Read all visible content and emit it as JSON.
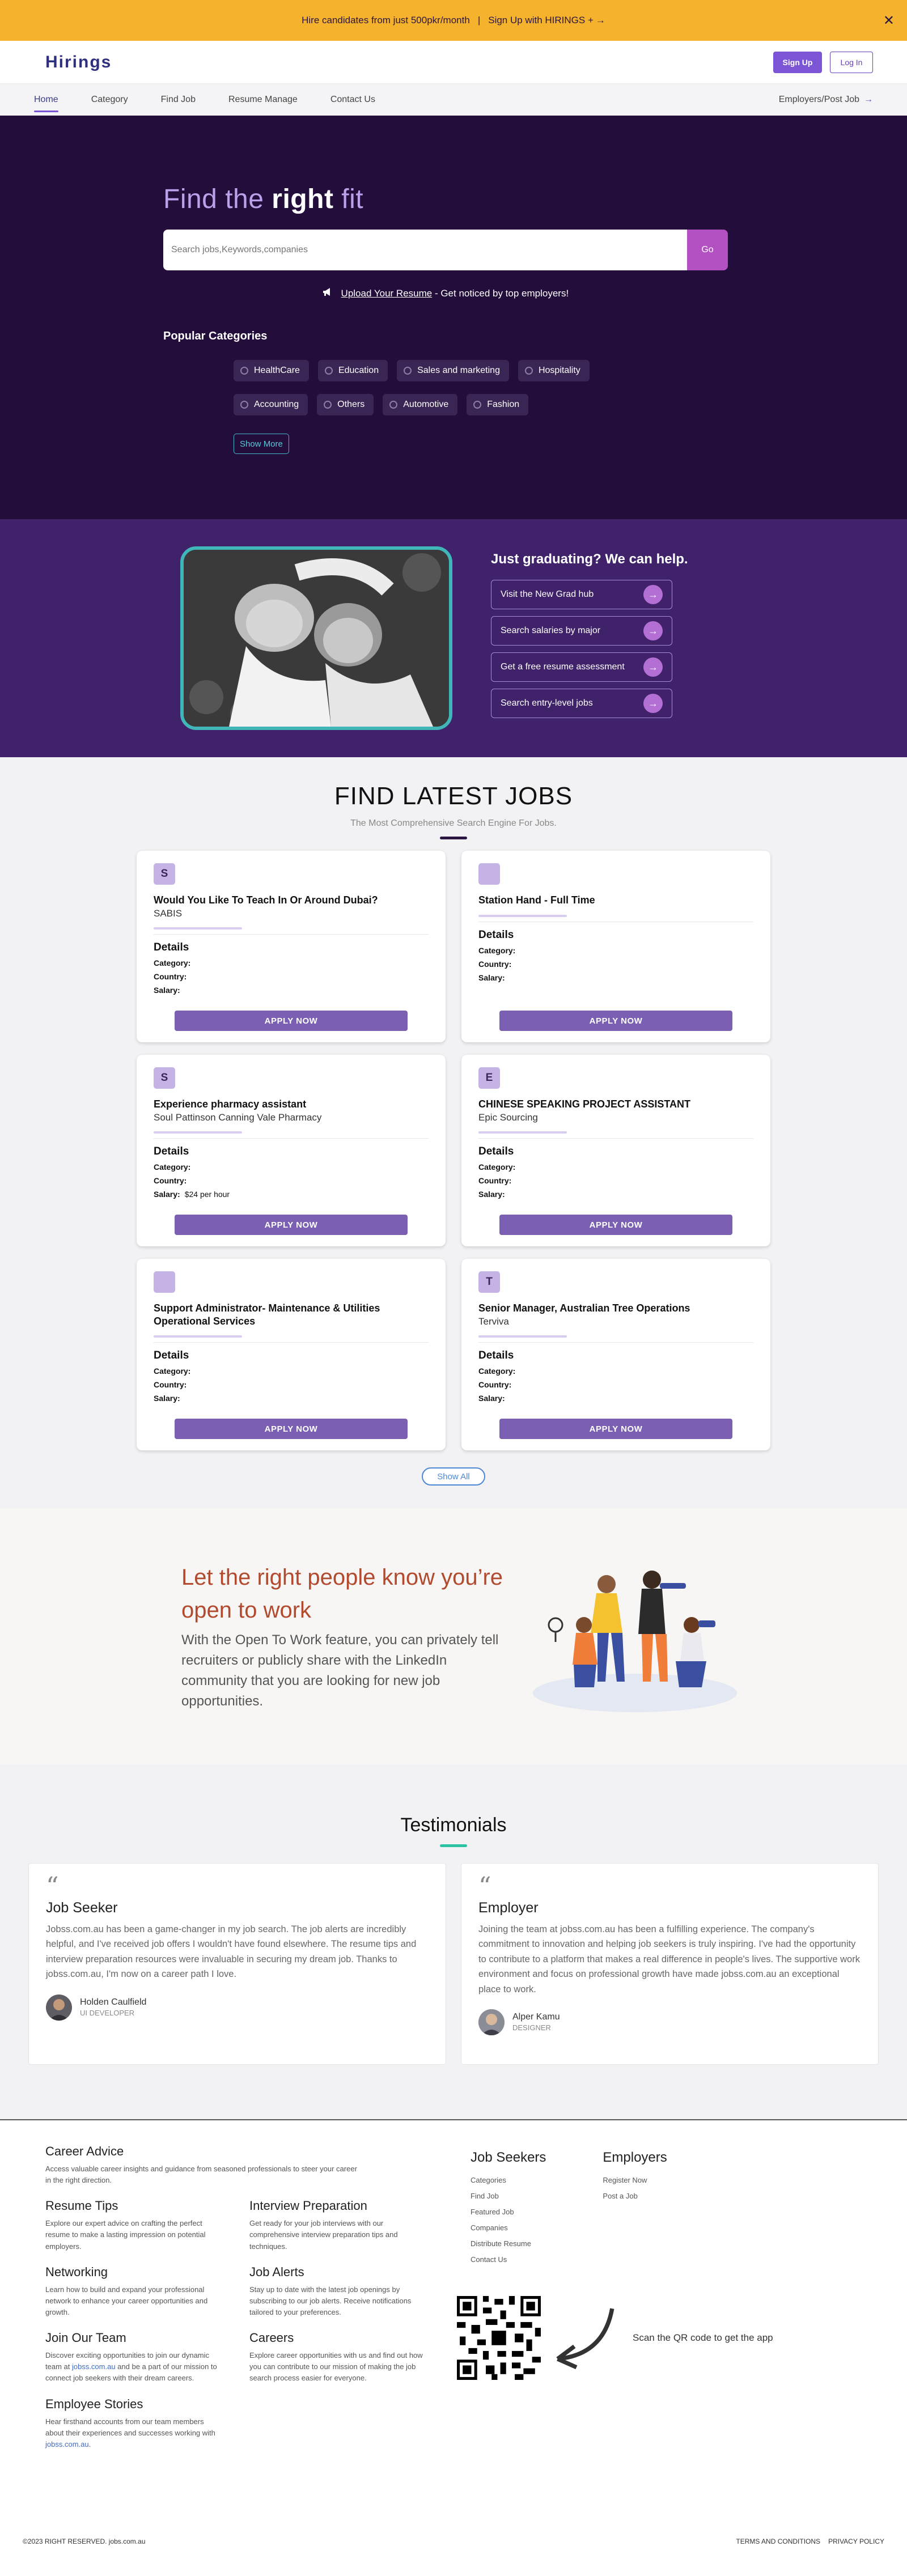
{
  "banner": {
    "text": "Hire candidates from just 500pkr/month",
    "cta": "Sign Up with HIRINGS +",
    "cta_arrow": "→",
    "close": "✕"
  },
  "brand": {
    "logo": "Hirings",
    "accent": "#7b55d6"
  },
  "auth": {
    "signup": "Sign Up",
    "login": "Log In"
  },
  "nav": {
    "items": [
      "Home",
      "Category",
      "Find Job",
      "Resume Manage",
      "Contact Us"
    ],
    "active": "Home",
    "employers": "Employers/Post Job",
    "employers_arrow": "→"
  },
  "hero": {
    "title_pre": "Find the ",
    "title_bold": "right",
    "title_post": " fit",
    "search_placeholder": "Search jobs,Keywords,companies",
    "go": "Go",
    "upload_link": "Upload Your Resume",
    "upload_text": " - Get noticed by top employers!",
    "popular_title": "Popular Categories",
    "categories": [
      "HealthCare",
      "Education",
      "Sales and marketing",
      "Hospitality",
      "Accounting",
      "Others",
      "Automotive",
      "Fashion"
    ],
    "show_more": "Show More"
  },
  "grad": {
    "title": "Just graduating? We can help.",
    "links": [
      "Visit the New Grad hub",
      "Search salaries by major",
      "Get a free resume assessment",
      "Search entry-level jobs"
    ],
    "link_icon": "→"
  },
  "jobs": {
    "title": "FIND LATEST JOBS",
    "subtitle": "The Most Comprehensive Search Engine For Jobs.",
    "details_label": "Details",
    "category_label": "Category:",
    "country_label": "Country:",
    "salary_label": "Salary:",
    "apply": "APPLY NOW",
    "show_all": "Show All",
    "cards": [
      {
        "badge": "S",
        "title": "Would You Like To Teach In Or Around Dubai?",
        "company": "SABIS",
        "category": "",
        "country": "",
        "salary": ""
      },
      {
        "badge": "",
        "title": "Station Hand - Full Time",
        "company": "",
        "category": "",
        "country": "",
        "salary": ""
      },
      {
        "badge": "S",
        "title": "Experience pharmacy assistant",
        "company": "Soul Pattinson Canning Vale Pharmacy",
        "category": "",
        "country": "",
        "salary": "$24 per hour"
      },
      {
        "badge": "E",
        "title": "CHINESE SPEAKING PROJECT ASSISTANT",
        "company": "Epic Sourcing",
        "category": "",
        "country": "",
        "salary": ""
      },
      {
        "badge": "",
        "title": "Support Administrator- Maintenance & Utilities Operational Services",
        "company": "",
        "category": "",
        "country": "",
        "salary": ""
      },
      {
        "badge": "T",
        "title": "Senior Manager, Australian Tree Operations",
        "company": "Terviva",
        "category": "",
        "country": "",
        "salary": ""
      }
    ]
  },
  "open_to_work": {
    "title": "Let the right people know you’re open to work",
    "body": "With the Open To Work feature, you can privately tell recruiters or publicly share with the LinkedIn community that you are looking for new job opportunities."
  },
  "testimonials": {
    "title": "Testimonials",
    "quote_mark": "“",
    "items": [
      {
        "heading": "Job Seeker",
        "text": "Jobss.com.au has been a game-changer in my job search. The job alerts are incredibly helpful, and I've received job offers I wouldn't have found elsewhere. The resume tips and interview preparation resources were invaluable in securing my dream job. Thanks to jobss.com.au, I'm now on a career path I love.",
        "name": "Holden Caulfield",
        "role": "UI DEVELOPER"
      },
      {
        "heading": "Employer",
        "text": "Joining the team at jobss.com.au has been a fulfilling experience. The company's commitment to innovation and helping job seekers is truly inspiring. I've had the opportunity to contribute to a platform that makes a real difference in people's lives. The supportive work environment and focus on professional growth have made jobss.com.au an exceptional place to work.",
        "name": "Alper Kamu",
        "role": "DESIGNER"
      }
    ]
  },
  "footer": {
    "career_advice": {
      "title": "Career Advice",
      "text": "Access valuable career insights and guidance from seasoned professionals to steer your career in the right direction."
    },
    "resume_tips": {
      "title": "Resume Tips",
      "text": "Explore our expert advice on crafting the perfect resume to make a lasting impression on potential employers."
    },
    "interview_prep": {
      "title": "Interview Preparation",
      "text": "Get ready for your job interviews with our comprehensive interview preparation tips and techniques."
    },
    "networking": {
      "title": "Networking",
      "text": "Learn how to build and expand your professional network to enhance your career opportunities and growth."
    },
    "job_alerts": {
      "title": "Job Alerts",
      "text": "Stay up to date with the latest job openings by subscribing to our job alerts. Receive notifications tailored to your preferences."
    },
    "join_team": {
      "title": "Join Our Team",
      "text_pre": "Discover exciting opportunities to join our dynamic team at ",
      "link": "jobss.com.au",
      "text_post": " and be a part of our mission to connect job seekers with their dream careers."
    },
    "careers": {
      "title": "Careers",
      "text": "Explore career opportunities with us and find out how you can contribute to our mission of making the job search process easier for everyone."
    },
    "stories": {
      "title": "Employee Stories",
      "text_pre": "Hear firsthand accounts from our team members about their experiences and successes working with ",
      "link": "jobss.com.au",
      "text_post": "."
    },
    "job_seekers": {
      "title": "Job Seekers",
      "links": [
        "Categories",
        "Find Job",
        "Featured Job",
        "Companies",
        "Distribute Resume",
        "Contact Us"
      ]
    },
    "employers": {
      "title": "Employers",
      "links": [
        "Register Now",
        "Post a Job"
      ]
    },
    "qr_text": "Scan the QR code to get the app",
    "copyright": "©2023 RIGHT RESERVED. jobs.com.au",
    "terms": "TERMS AND CONDITIONS",
    "privacy": "PRIVACY POLICY"
  }
}
